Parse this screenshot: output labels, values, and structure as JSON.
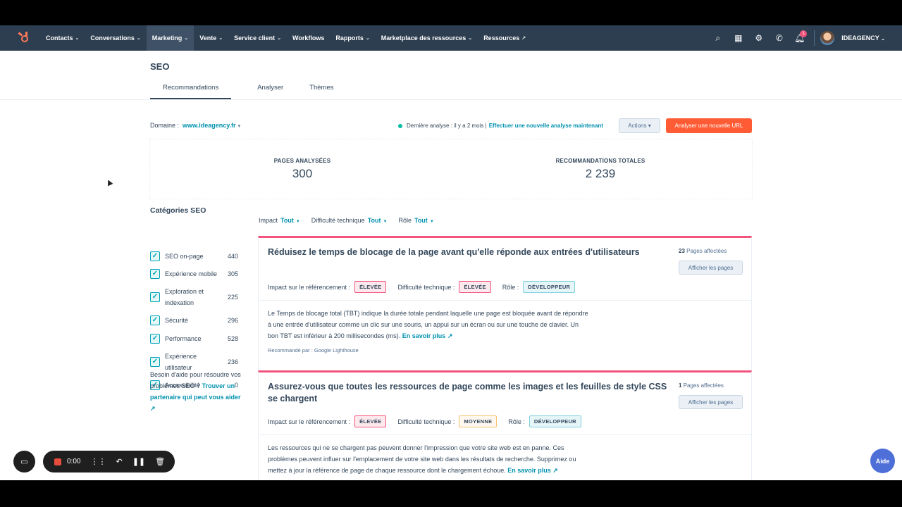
{
  "nav": {
    "items": [
      {
        "label": "Contacts",
        "chev": "⌄"
      },
      {
        "label": "Conversations",
        "chev": "⌄"
      },
      {
        "label": "Marketing",
        "chev": "⌄"
      },
      {
        "label": "Vente",
        "chev": "⌄"
      },
      {
        "label": "Service client",
        "chev": "⌄"
      },
      {
        "label": "Workflows",
        "chev": ""
      },
      {
        "label": "Rapports",
        "chev": "⌄"
      },
      {
        "label": "Marketplace des ressources",
        "chev": "⌄"
      },
      {
        "label": "Ressources",
        "chev": "↗"
      }
    ],
    "notification_count": "1",
    "account": "IDEAGENCY"
  },
  "page": {
    "title": "SEO",
    "tabs": [
      "Recommandations",
      "Analyser",
      "Thèmes"
    ]
  },
  "domain": {
    "label": "Domaine :",
    "value": "www.ideagency.fr",
    "last_analysis": "Dernière analyse : il y a 2 mois |",
    "new_analysis_link": "Effectuer une nouvelle analyse maintenant",
    "actions_label": "Actions ▾",
    "analyze_url_label": "Analyser une nouvelle URL"
  },
  "stats": {
    "pages_label": "PAGES ANALYSÉES",
    "pages_value": "300",
    "recs_label": "RECOMMANDATIONS TOTALES",
    "recs_value": "2 239"
  },
  "sidebar": {
    "title": "Catégories SEO",
    "categories": [
      {
        "name": "SEO on-page",
        "count": "440"
      },
      {
        "name": "Expérience mobile",
        "count": "305"
      },
      {
        "name": "Exploration et indexation",
        "count": "225"
      },
      {
        "name": "Sécurité",
        "count": "296"
      },
      {
        "name": "Performance",
        "count": "528"
      },
      {
        "name": "Expérience utilisateur",
        "count": "236"
      },
      {
        "name": "Accessibilité",
        "count": "0"
      }
    ],
    "help_text": "Besoin d'aide pour résoudre vos problèmes SEO ?",
    "help_link": "Trouver un partenaire qui peut vous aider"
  },
  "filters": [
    {
      "label": "Impact",
      "value": "Tout"
    },
    {
      "label": "Difficulté technique",
      "value": "Tout"
    },
    {
      "label": "Rôle",
      "value": "Tout"
    }
  ],
  "cards": [
    {
      "title": "Réduisez le temps de blocage de la page avant qu'elle réponde aux entrées d'utilisateurs",
      "affected_count": "23",
      "affected_label": "Pages affectées",
      "pages_button": "Afficher les pages",
      "impact_label": "Impact sur le référencement :",
      "impact": "ÉLEVÉE",
      "difficulty_label": "Difficulté technique :",
      "difficulty": "ÉLEVÉE",
      "role_label": "Rôle :",
      "role": "DÉVELOPPEUR",
      "description": "Le Temps de blocage total (TBT) indique la durée totale pendant laquelle une page est bloquée avant de répondre à une entrée d'utilisateur comme un clic sur une souris, un appui sur un écran ou sur une touche de clavier. Un bon TBT est inférieur à 200 millisecondes (ms).",
      "learn_more": "En savoir plus",
      "recommended_by": "Recommandé par : Google Lighthouse"
    },
    {
      "title": "Assurez-vous que toutes les ressources de page comme les images et les feuilles de style CSS se chargent",
      "affected_count": "1",
      "affected_label": "Pages affectées",
      "pages_button": "Afficher les pages",
      "impact_label": "Impact sur le référencement :",
      "impact": "ÉLEVÉE",
      "difficulty_label": "Difficulté technique :",
      "difficulty": "MOYENNE",
      "role_label": "Rôle :",
      "role": "DÉVELOPPEUR",
      "description": "Les ressources qui ne se chargent pas peuvent donner l'impression que votre site web est en panne. Ces problèmes peuvent influer sur l'emplacement de votre site web dans les résultats de recherche. Supprimez ou mettez à jour la référence de page de chaque ressource dont le chargement échoue.",
      "learn_more": "En savoir plus"
    }
  ],
  "recorder": {
    "time": "0:00"
  },
  "help_button": "Aide",
  "colors": {
    "nav": "#2d3e50",
    "accent": "#0091ae",
    "cta": "#ff5c35",
    "card_border": "#f2547d"
  }
}
